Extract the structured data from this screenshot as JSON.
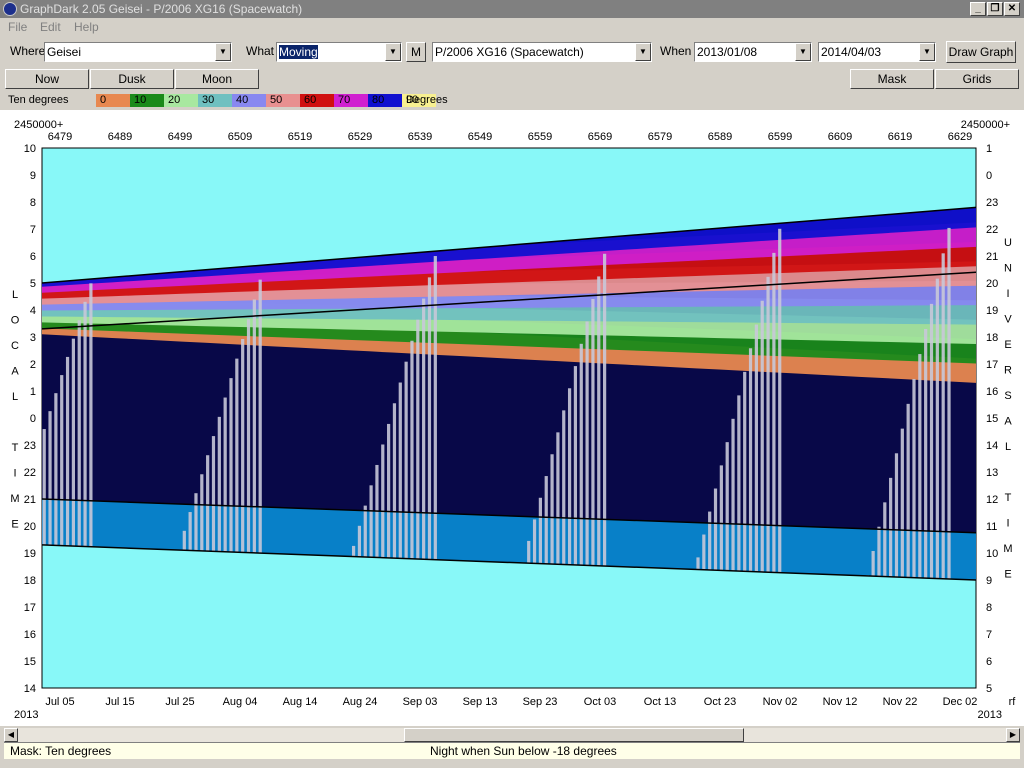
{
  "window": {
    "title": "GraphDark 2.05  Geisei  -  P/2006 XG16 (Spacewatch)",
    "minimize": "_",
    "restore": "❐",
    "close": "✕"
  },
  "menu": [
    "File",
    "Edit",
    "Help"
  ],
  "toolbar": {
    "where_label": "Where",
    "where_value": "Geisei",
    "what_label": "What",
    "what_value": "Moving",
    "m_button": "M",
    "object_value": "P/2006 XG16 (Spacewatch)",
    "when_label": "When",
    "start_date": "2013/01/08",
    "end_date": "2014/04/03",
    "draw_button": "Draw Graph",
    "now_button": "Now",
    "dusk_button": "Dusk",
    "moon_button": "Moon",
    "mask_button": "Mask",
    "grids_button": "Grids"
  },
  "legend": {
    "title": "Ten degrees",
    "unit": "Degrees",
    "labels": [
      "0",
      "10",
      "20",
      "30",
      "40",
      "50",
      "60",
      "70",
      "80",
      "90"
    ],
    "colors": [
      "#e88850",
      "#1a8a1a",
      "#a8e8a0",
      "#70c0c0",
      "#8888f0",
      "#e89090",
      "#d01010",
      "#d020d0",
      "#1010d0",
      "#f8f090"
    ]
  },
  "chart_data": {
    "type": "heatmap",
    "jd_prefix": "2450000+",
    "jd_ticks": [
      "6479",
      "6489",
      "6499",
      "6509",
      "6519",
      "6529",
      "6539",
      "6549",
      "6559",
      "6569",
      "6579",
      "6589",
      "6599",
      "6609",
      "6619",
      "6629"
    ],
    "date_ticks": [
      "Jul 05",
      "Jul 15",
      "Jul 25",
      "Aug 04",
      "Aug 14",
      "Aug 24",
      "Sep 03",
      "Sep 13",
      "Sep 23",
      "Oct 03",
      "Oct 13",
      "Oct 23",
      "Nov 02",
      "Nov 12",
      "Nov 22",
      "Dec 02"
    ],
    "year_left": "2013",
    "year_right": "2013",
    "rf_label": "rf",
    "left_axis_ticks": [
      "10",
      "9",
      "8",
      "7",
      "6",
      "5",
      "4",
      "3",
      "2",
      "1",
      "0",
      "23",
      "22",
      "21",
      "20",
      "19",
      "18",
      "17",
      "16",
      "15",
      "14"
    ],
    "right_axis_ticks": [
      "1",
      "0",
      "23",
      "22",
      "21",
      "20",
      "19",
      "18",
      "17",
      "16",
      "15",
      "14",
      "13",
      "12",
      "11",
      "10",
      "9",
      "8",
      "7",
      "6",
      "5"
    ],
    "left_axis_letters": [
      "L",
      "O",
      "C",
      "A",
      "L",
      "",
      "T",
      "I",
      "M",
      "E"
    ],
    "right_axis_letters": [
      "U",
      "N",
      "I",
      "V",
      "E",
      "R",
      "S",
      "A",
      "L",
      "",
      "T",
      "I",
      "M",
      "E"
    ],
    "colors": {
      "day": "#88f8f8",
      "twilight": "#0880c8",
      "night": "#080848",
      "moonlight": "#c8c8d8"
    }
  },
  "status": {
    "mask": "Mask:  Ten degrees",
    "night": "Night when Sun below -18 degrees"
  }
}
